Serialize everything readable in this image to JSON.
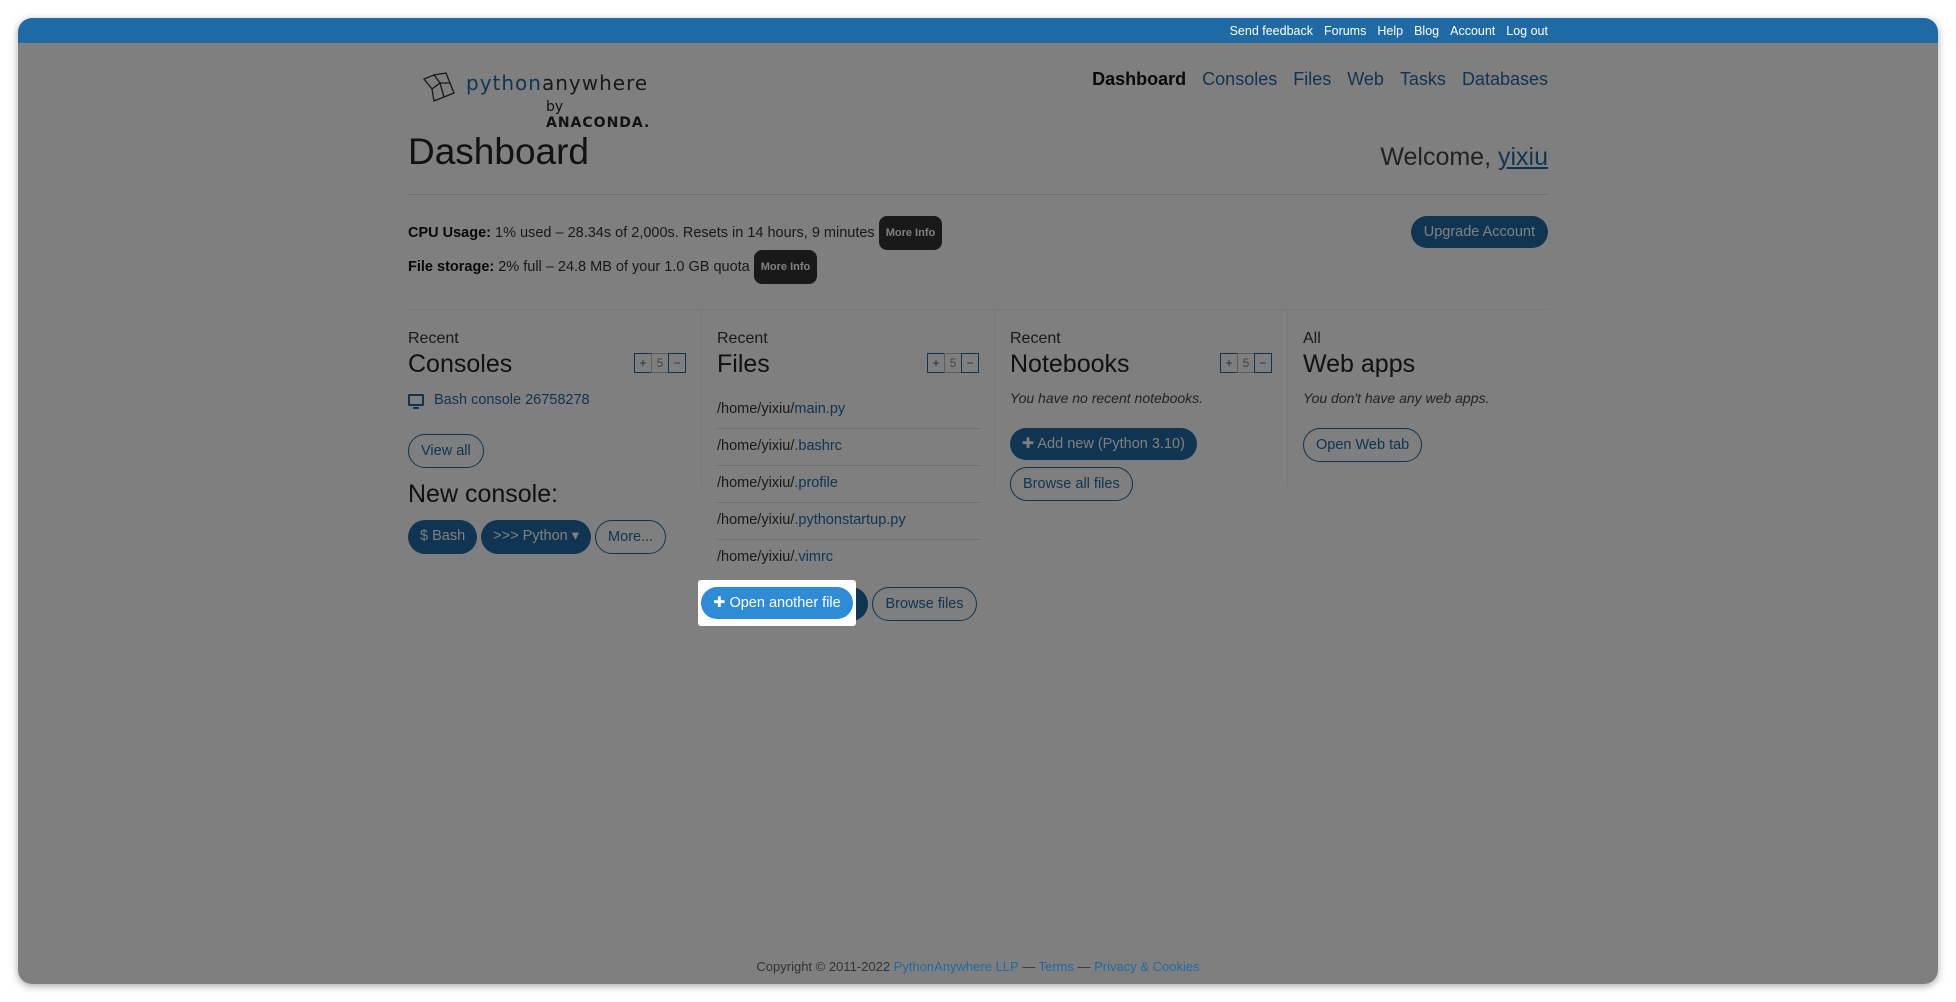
{
  "topbar": {
    "links": [
      "Send feedback",
      "Forums",
      "Help",
      "Blog",
      "Account",
      "Log out"
    ]
  },
  "brand": {
    "name_part1": "python",
    "name_part2": "anywhere",
    "by": "by",
    "company": "ANACONDA."
  },
  "nav": [
    "Dashboard",
    "Consoles",
    "Files",
    "Web",
    "Tasks",
    "Databases"
  ],
  "page": {
    "title": "Dashboard",
    "welcome_prefix": "Welcome, ",
    "username": "yixiu"
  },
  "usage": {
    "cpu_label": "CPU Usage:",
    "cpu_text": " 1% used – 28.34s of 2,000s. Resets in 14 hours, 9 minutes ",
    "storage_label": "File storage:",
    "storage_text": " 2% full – 24.8 MB of your 1.0 GB quota ",
    "more_info": "More Info",
    "upgrade": "Upgrade Account"
  },
  "consoles": {
    "kicker": "Recent",
    "title": "Consoles",
    "count": "5",
    "items": [
      "Bash console 26758278"
    ],
    "view_all": "View all",
    "new_console_title": "New console:",
    "buttons": [
      "$ Bash",
      ">>> Python ▾",
      "More..."
    ]
  },
  "files": {
    "kicker": "Recent",
    "title": "Files",
    "count": "5",
    "items": [
      {
        "dir": "/home/yixiu/",
        "name": "main.py"
      },
      {
        "dir": "/home/yixiu/",
        "name": ".bashrc"
      },
      {
        "dir": "/home/yixiu/",
        "name": ".profile"
      },
      {
        "dir": "/home/yixiu/",
        "name": ".pythonstartup.py"
      },
      {
        "dir": "/home/yixiu/",
        "name": ".vimrc"
      }
    ],
    "open_another": "Open another file",
    "browse": "Browse files"
  },
  "notebooks": {
    "kicker": "Recent",
    "title": "Notebooks",
    "count": "5",
    "empty": "You have no recent notebooks.",
    "add_new": "Add new (Python 3.10)",
    "browse_all": "Browse all files"
  },
  "webapps": {
    "kicker": "All",
    "title": "Web apps",
    "empty": "You don't have any web apps.",
    "open_tab": "Open Web tab"
  },
  "footer": {
    "copyright": "Copyright © 2011-2022 ",
    "company": "PythonAnywhere LLP",
    "sep1": " — ",
    "terms": "Terms",
    "sep2": " — ",
    "privacy": "Privacy & Cookies"
  }
}
